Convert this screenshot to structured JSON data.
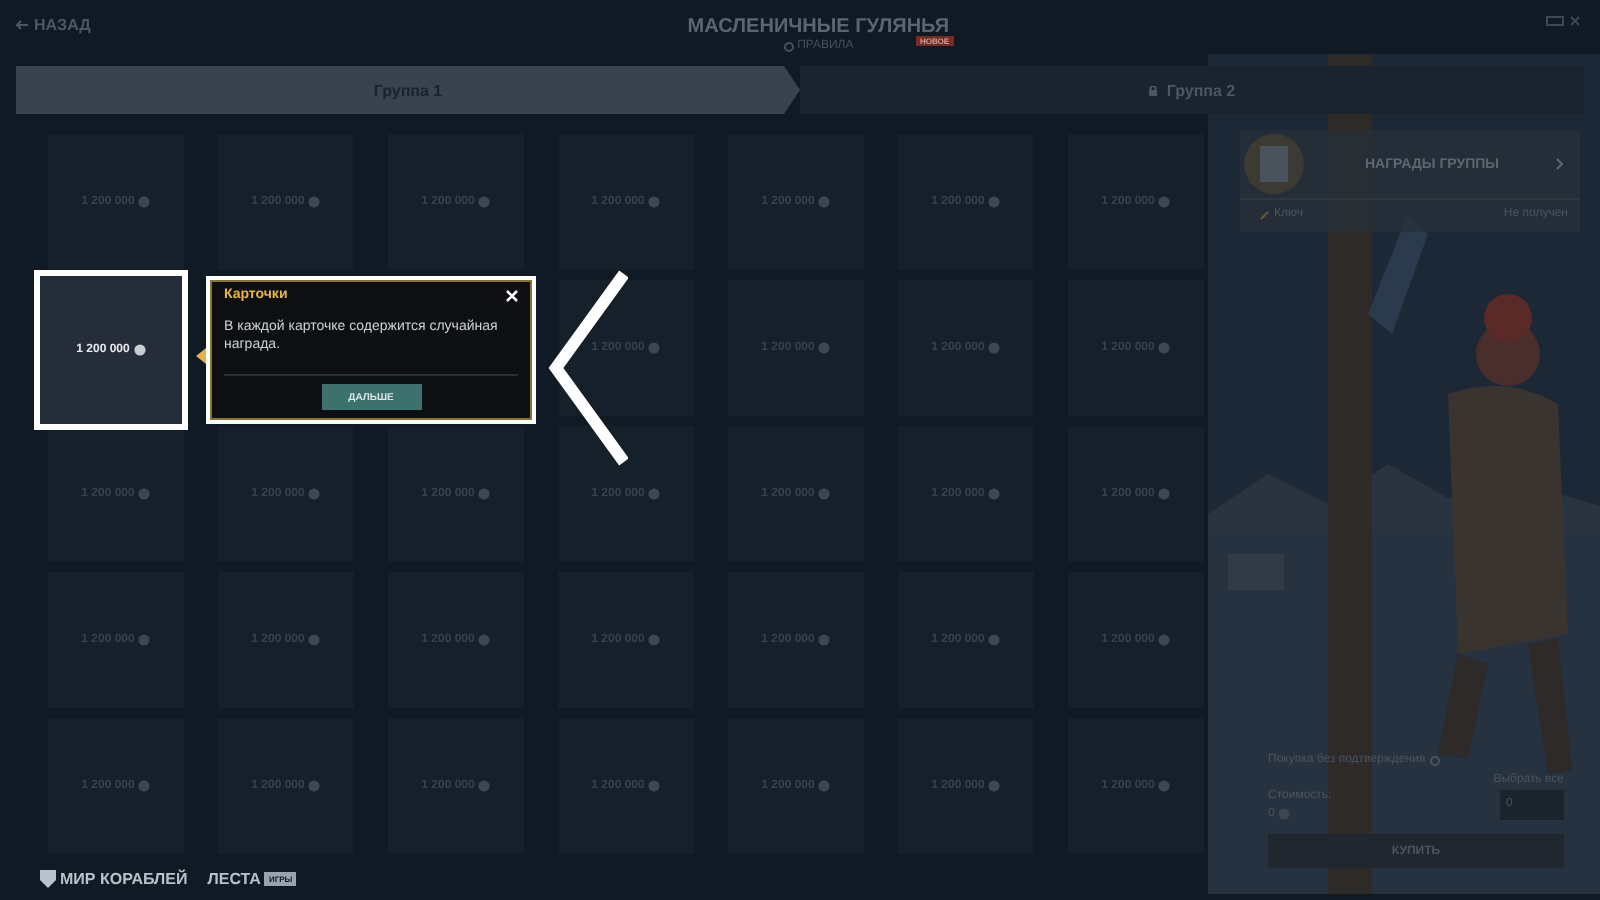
{
  "header": {
    "back": "НАЗАД",
    "title": "МАСЛЕНИЧНЫЕ ГУЛЯНЬЯ",
    "badge": "НОВОЕ",
    "rules": "ПРАВИЛА"
  },
  "tabs": [
    {
      "label": "Группа  1",
      "selected": true,
      "locked": false
    },
    {
      "label": "Группа  2",
      "selected": false,
      "locked": true
    }
  ],
  "grid": [
    [
      {
        "kind": "card",
        "amount": "1 200 000",
        "selected": false
      },
      {
        "kind": "card",
        "amount": "1 200 000",
        "selected": false
      },
      {
        "kind": "card",
        "amount": "1 200 000",
        "selected": false
      },
      {
        "kind": "card",
        "amount": "1 200 000",
        "selected": false
      },
      {
        "kind": "card",
        "amount": "1 200 000",
        "selected": false
      },
      {
        "kind": "card",
        "amount": "1 200 000",
        "selected": false
      },
      {
        "kind": "card",
        "amount": "1 200 000",
        "selected": false
      }
    ],
    [
      {
        "kind": "card",
        "amount": "1 200 000",
        "selected": true
      },
      {
        "kind": "tooltip",
        "title": "Карточки",
        "text": "В каждой карточке содержится случайная награда.",
        "button": "ДАЛЬШЕ"
      },
      {
        "kind": "card",
        "amount": "1 200 000",
        "selected": false
      },
      {
        "kind": "card",
        "amount": "1 200 000",
        "selected": false
      },
      {
        "kind": "card",
        "amount": "1 200 000",
        "selected": false
      },
      {
        "kind": "card",
        "amount": "1 200 000",
        "selected": false
      }
    ],
    [
      {
        "kind": "card",
        "amount": "1 200 000",
        "selected": false
      },
      {
        "kind": "card",
        "amount": "1 200 000",
        "selected": false
      },
      {
        "kind": "card",
        "amount": "1 200 000",
        "selected": false
      },
      {
        "kind": "card",
        "amount": "1 200 000",
        "selected": false
      },
      {
        "kind": "card",
        "amount": "1 200 000",
        "selected": false
      },
      {
        "kind": "card",
        "amount": "1 200 000",
        "selected": false
      },
      {
        "kind": "card",
        "amount": "1 200 000",
        "selected": false
      }
    ],
    [
      {
        "kind": "card",
        "amount": "1 200 000",
        "selected": false
      },
      {
        "kind": "card",
        "amount": "1 200 000",
        "selected": false
      },
      {
        "kind": "card",
        "amount": "1 200 000",
        "selected": false
      },
      {
        "kind": "card",
        "amount": "1 200 000",
        "selected": false
      },
      {
        "kind": "card",
        "amount": "1 200 000",
        "selected": false
      },
      {
        "kind": "card",
        "amount": "1 200 000",
        "selected": false
      },
      {
        "kind": "card",
        "amount": "1 200 000",
        "selected": false
      }
    ],
    [
      {
        "kind": "card",
        "amount": "1 200 000",
        "selected": false
      },
      {
        "kind": "card",
        "amount": "1 200 000",
        "selected": false
      },
      {
        "kind": "card",
        "amount": "1 200 000",
        "selected": false
      },
      {
        "kind": "card",
        "amount": "1 200 000",
        "selected": false
      },
      {
        "kind": "card",
        "amount": "1 200 000",
        "selected": false
      },
      {
        "kind": "card",
        "amount": "1 200 000",
        "selected": false
      },
      {
        "kind": "card",
        "amount": "1 200 000",
        "selected": false
      }
    ]
  ],
  "rewards": {
    "title": "НАГРАДЫ ГРУППЫ",
    "item": "Ключ",
    "status": "Не получен"
  },
  "purchase": {
    "no_confirm": "Покупка без подтверждения",
    "select_all": "Выбрать все",
    "cost_label": "Стоимость:",
    "cost": "0",
    "quantity": "0",
    "buy": "КУПИТЬ"
  },
  "footer": {
    "brand": "МИР КОРАБЛЕЙ",
    "publisher": "ЛЕСТА",
    "publisher_badge": "ИГРЫ"
  }
}
